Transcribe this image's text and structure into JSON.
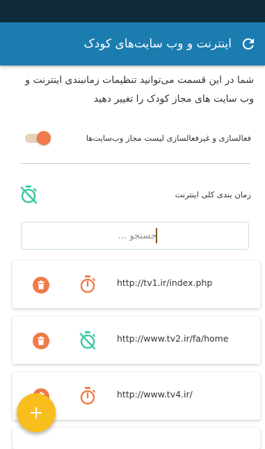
{
  "appbar": {
    "title": "اینترنت و وب سایت‌های کودک",
    "refresh_icon": "refresh-icon",
    "color": "#1b7cb0"
  },
  "description": "شما در این قسمت می‌توانید تنظیمات زمانبندی اینترنت و وب سایت های مجاز کودک را تغییر دهید",
  "whitelist_toggle": {
    "label": "فعالسازی و غیرفعالسازی لیست مجاز وب‌سایت‌ها",
    "checked": true
  },
  "internet_schedule": {
    "label": "زمان بندی کلی اینترنت",
    "icon": "timer-off-icon"
  },
  "search": {
    "placeholder": "جستجو ...",
    "value": ""
  },
  "sites": [
    {
      "url": "http://tv1.ir/index.php",
      "timer_icon": "timer-icon",
      "timer_color": "#f07a4a"
    },
    {
      "url": "http://www.tv2.ir/fa/home",
      "timer_icon": "timer-off-icon",
      "timer_color": "#3cc8a4"
    },
    {
      "url": "http://www.tv4.ir/",
      "timer_icon": "timer-icon",
      "timer_color": "#f07a4a"
    }
  ],
  "colors": {
    "accent_orange": "#f07a4a",
    "accent_teal": "#3cc8a4",
    "fab": "#f7be1e"
  },
  "fab": {
    "icon": "plus-icon"
  }
}
